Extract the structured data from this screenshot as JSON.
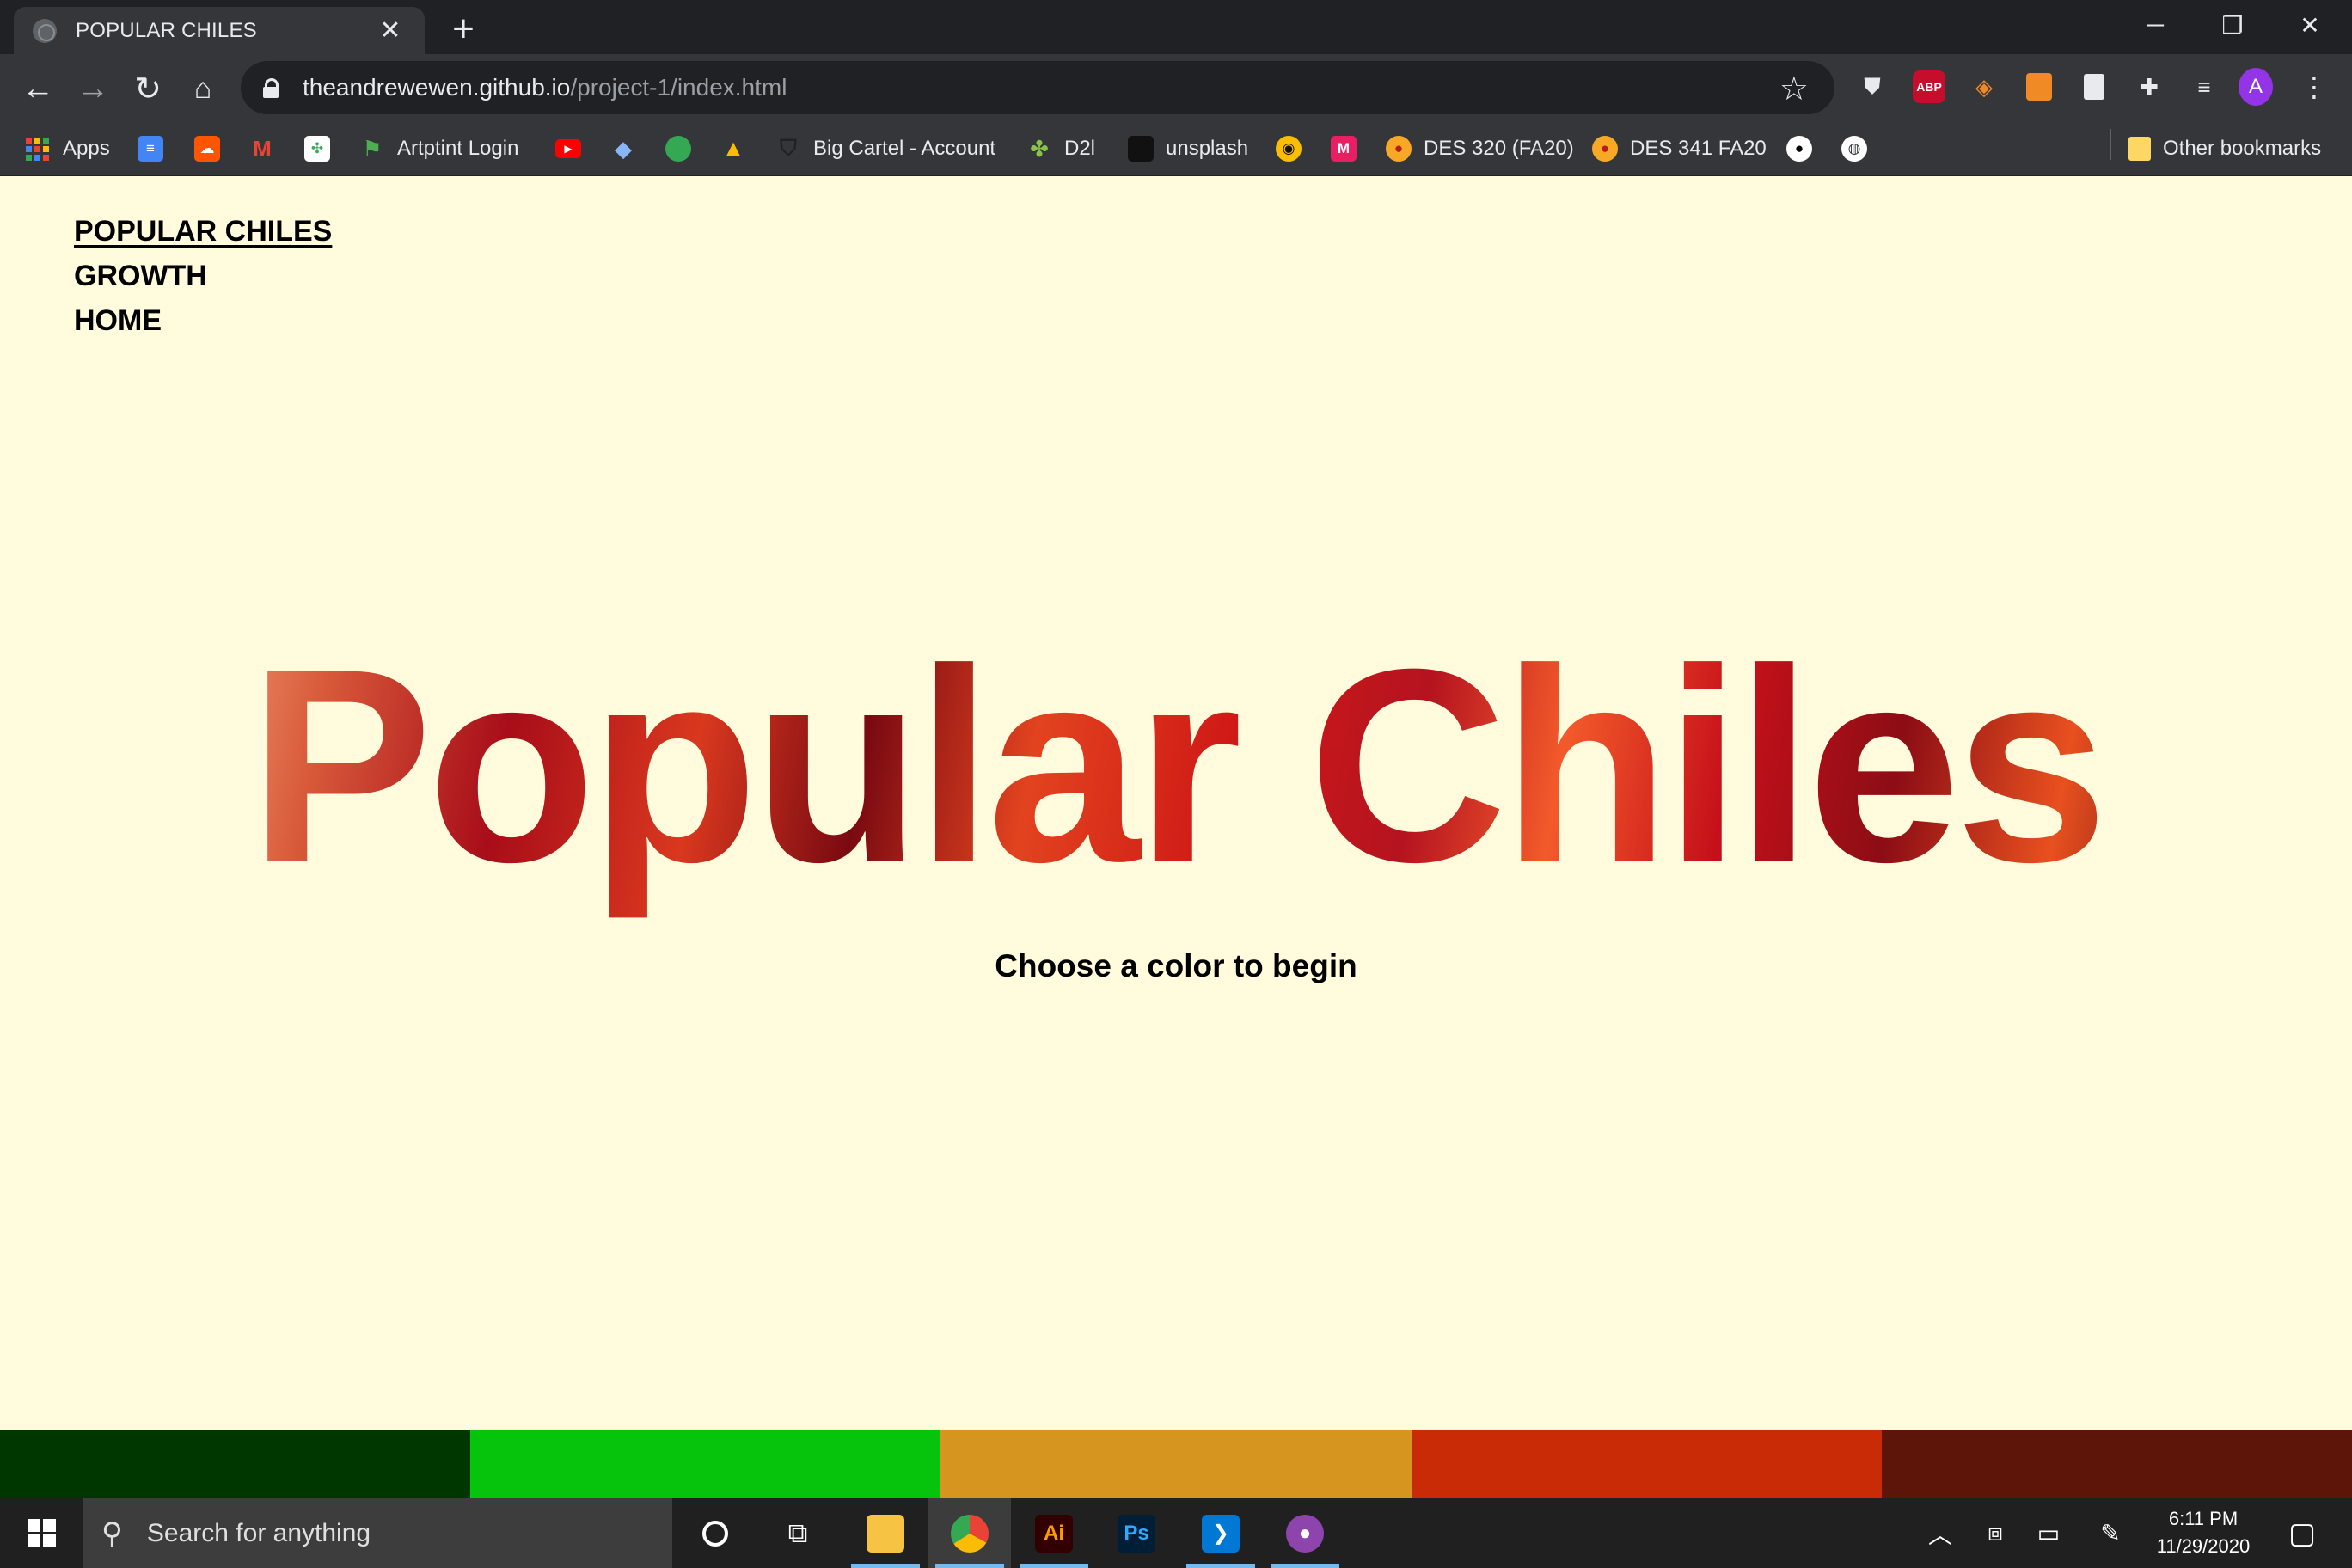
{
  "browser": {
    "tab_title": "POPULAR CHILES",
    "tab_close": "✕",
    "new_tab": "+",
    "url_host": "theandrewewen.github.io",
    "url_path": "/project-1/index.html",
    "profile_initial": "A",
    "abp_label": "ABP"
  },
  "bookmarks": {
    "items": [
      {
        "label": "Apps",
        "icon": "apps-grid-icon"
      },
      {
        "label": "",
        "icon": "docs-icon"
      },
      {
        "label": "",
        "icon": "soundcloud-icon"
      },
      {
        "label": "",
        "icon": "gmail-icon"
      },
      {
        "label": "",
        "icon": "clover-icon"
      },
      {
        "label": "Artptint Login",
        "icon": "flag-icon"
      },
      {
        "label": "",
        "icon": "youtube-icon"
      },
      {
        "label": "",
        "icon": "diamond-icon"
      },
      {
        "label": "",
        "icon": "blob-icon"
      },
      {
        "label": "",
        "icon": "drive-icon"
      },
      {
        "label": "Big Cartel - Account",
        "icon": "bigcartel-icon"
      },
      {
        "label": "D2l",
        "icon": "d2l-icon"
      },
      {
        "label": "unsplash",
        "icon": "unsplash-icon"
      },
      {
        "label": "",
        "icon": "magnifier-duck-icon"
      },
      {
        "label": "",
        "icon": "m-icon"
      },
      {
        "label": "DES 320 (FA20)",
        "icon": "course-icon"
      },
      {
        "label": "DES 341 FA20",
        "icon": "course-icon"
      },
      {
        "label": "",
        "icon": "github-icon"
      },
      {
        "label": "",
        "icon": "globe-icon"
      }
    ],
    "other": "Other bookmarks"
  },
  "site": {
    "nav": [
      "POPULAR CHILES",
      "GROWTH",
      "HOME"
    ],
    "hero_title": "Popular Chiles",
    "subtitle": "Choose a color to begin",
    "swatch_colors": [
      "#003600",
      "#05c40b",
      "#d6951e",
      "#c92b07",
      "#5c1508"
    ]
  },
  "taskbar": {
    "search_placeholder": "Search for anything",
    "apps": [
      "cortana-icon",
      "task-view-icon",
      "file-explorer-icon",
      "chrome-icon",
      "illustrator-icon",
      "photoshop-icon",
      "vscode-icon",
      "github-desktop-icon"
    ],
    "illustrator_label": "Ai",
    "photoshop_label": "Ps",
    "time": "6:11 PM",
    "date": "11/29/2020"
  }
}
